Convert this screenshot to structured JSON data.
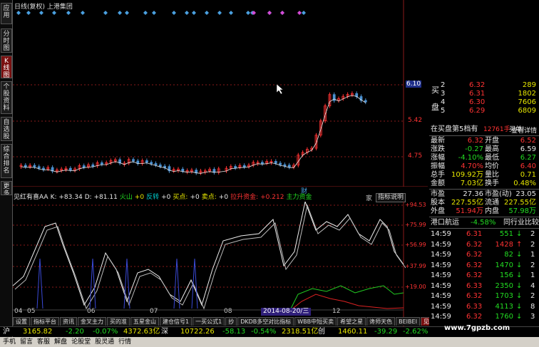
{
  "main_title": "日线(复权)  上港集团",
  "left_tabs": [
    {
      "label": "应用"
    },
    {
      "label": "分时图"
    },
    {
      "label": "K线图",
      "active": true
    },
    {
      "label": "个股资料"
    },
    {
      "label": "自选股"
    },
    {
      "label": "综合排名"
    },
    {
      "label": "更多"
    }
  ],
  "price_scale": [
    "6.10",
    "5.42",
    "4.75"
  ],
  "markers": {
    "fa_label": "财"
  },
  "indicator": {
    "name": "见红有喜AA",
    "k": "K: +83.34",
    "d": "D: +81.11",
    "huoshan": "火山",
    "fanzhuan_val": "+0",
    "fanzhuan": "反转",
    "buy_val": "+0",
    "buy": "买点:",
    "buy_num": "+0",
    "sell": "卖点:",
    "sell_val": "+0",
    "lashen": "拉升资金:",
    "lashen_val": "+0.212",
    "zhuli": "主力资金",
    "btn": "指标说明",
    "tag": "家",
    "scale": [
      "+94.53",
      "+75.99",
      "+56.99",
      "+37.99",
      "+19.00"
    ]
  },
  "x_axis": [
    "04",
    "05",
    "06",
    "07",
    "08",
    "11",
    "12"
  ],
  "date_box": "2014-08-20/三",
  "bottom_tabs": [
    {
      "label": "设置"
    },
    {
      "label": "指标平台"
    },
    {
      "label": "资讯"
    },
    {
      "label": "金叉主力"
    },
    {
      "label": "买的准"
    },
    {
      "label": "五星金山"
    },
    {
      "label": "建仓信号1"
    },
    {
      "label": "一买公式1"
    },
    {
      "label": "抄"
    },
    {
      "label": "DKDB多空对比指标"
    },
    {
      "label": "WBB中短买卖"
    },
    {
      "label": "希望之星"
    },
    {
      "label": "谗师天色"
    },
    {
      "label": "BEIBEI"
    },
    {
      "label": "见红有1",
      "active": true
    }
  ],
  "status": {
    "sh_label": "沪",
    "sh_index": "3165.82",
    "sh_chg": "-2.20",
    "sh_pct": "-0.07%",
    "sh_amt": "4372.63亿",
    "sz_label": "深",
    "sz_index": "10722.26",
    "sz_chg": "-58.13",
    "sz_pct": "-0.54%",
    "sz_amt": "2318.51亿",
    "cy_label": "创",
    "cy_index": "1460.11",
    "cy_chg": "-39.29",
    "cy_pct": "-2.62%"
  },
  "menu": [
    "手机",
    "留言",
    "客服",
    "解盘",
    "论股堂",
    "股灵通",
    "行情"
  ],
  "right_panel": {
    "buy_label_1": "买",
    "buy_label_2": "盘",
    "buy_rows": [
      {
        "n": "2",
        "price": "6.32",
        "vol": "289"
      },
      {
        "n": "3",
        "price": "6.31",
        "vol": "1802"
      },
      {
        "n": "4",
        "price": "6.30",
        "vol": "7606"
      },
      {
        "n": "5",
        "price": "6.29",
        "vol": "6809"
      }
    ],
    "top_price": "6.10",
    "queue_text": "在买盘第5档有",
    "queue_vol": "12761手",
    "queue_buy": "买单!",
    "queue_detail": "查看详情",
    "quotes": [
      {
        "l1": "最新",
        "v1": "6.32",
        "c1": "red",
        "l2": "开盘",
        "v2": "6.52",
        "c2": "red"
      },
      {
        "l1": "涨跌",
        "v1": "-0.27",
        "c1": "green",
        "l2": "最高",
        "v2": "6.59",
        "c2": "white"
      },
      {
        "l1": "涨幅",
        "v1": "-4.10%",
        "c1": "green",
        "l2": "最低",
        "v2": "6.27",
        "c2": "green"
      },
      {
        "l1": "振幅",
        "v1": "4.70%",
        "c1": "red",
        "l2": "均价",
        "v2": "6.40",
        "c2": "red"
      },
      {
        "l1": "总手",
        "v1": "109.92万",
        "c1": "yellow",
        "l2": "量比",
        "v2": "0.71",
        "c2": "yellow"
      },
      {
        "l1": "金额",
        "v1": "7.03亿",
        "c1": "yellow",
        "l2": "换手",
        "v2": "0.48%",
        "c2": "yellow"
      }
    ],
    "quotes2": [
      {
        "l1": "市盈",
        "v1": "27.36",
        "c1": "white",
        "l2": "市盈(动)",
        "v2": "23.05",
        "c2": "white"
      },
      {
        "l1": "股本",
        "v1": "227.55亿",
        "c1": "yellow",
        "l2": "流通",
        "v2": "227.55亿",
        "c2": "yellow"
      },
      {
        "l1": "外盘",
        "v1": "51.94万",
        "c1": "red",
        "l2": "内盘",
        "v2": "57.98万",
        "c2": "green"
      }
    ],
    "sector_name": "港口航运",
    "sector_pct": "-4.58%",
    "sector_link": "同行业比较",
    "ticks": [
      {
        "t": "14:59",
        "p": "6.31",
        "v": "551",
        "arrow": "down",
        "n": "2"
      },
      {
        "t": "14:59",
        "p": "6.32",
        "v": "1428",
        "arrow": "up",
        "n": "2"
      },
      {
        "t": "14:59",
        "p": "6.32",
        "v": "82",
        "arrow": "down",
        "n": "1"
      },
      {
        "t": "14:59",
        "p": "6.32",
        "v": "1470",
        "arrow": "down",
        "n": "2"
      },
      {
        "t": "14:59",
        "p": "6.32",
        "v": "156",
        "arrow": "down",
        "n": "1"
      },
      {
        "t": "14:59",
        "p": "6.33",
        "v": "2350",
        "arrow": "down",
        "n": "4"
      },
      {
        "t": "14:59",
        "p": "6.32",
        "v": "1703",
        "arrow": "down",
        "n": "2"
      },
      {
        "t": "14:59",
        "p": "6.33",
        "v": "4113",
        "arrow": "down",
        "n": "8"
      },
      {
        "t": "14:59",
        "p": "6.32",
        "v": "1760",
        "arrow": "down",
        "n": "3"
      }
    ]
  },
  "watermark": "www.7gpzb.com",
  "colors": {
    "up": "#ff3333",
    "down": "#22dd22",
    "diamond": "#4aa0e0",
    "ma": "#e8e8e8"
  }
}
